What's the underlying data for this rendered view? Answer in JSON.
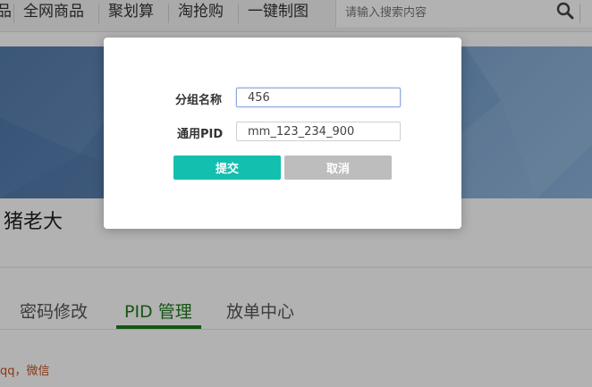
{
  "nav": {
    "items": [
      "全网商品",
      "聚划算",
      "淘抢购",
      "一键制图"
    ]
  },
  "search": {
    "placeholder": "请输入搜索内容"
  },
  "profile": {
    "username": "猪老大"
  },
  "tabs": [
    "密码修改",
    "PID 管理",
    "放单中心"
  ],
  "note": "qq，微信",
  "modal": {
    "group_name_label": "分组名称",
    "group_name_value": "456",
    "pid_label": "通用PID",
    "pid_value": "mm_123_234_900",
    "submit_label": "提交",
    "cancel_label": "取消"
  },
  "colors": {
    "submit": "#13bfae",
    "cancel": "#bdbdbd",
    "active_tab": "#1f7a1f"
  }
}
